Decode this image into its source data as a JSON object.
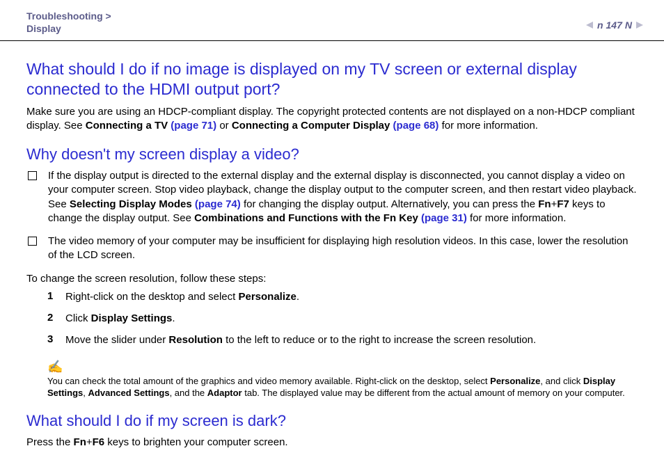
{
  "header": {
    "breadcrumb_line1": "Troubleshooting >",
    "breadcrumb_line2": "Display",
    "page_number": "147",
    "n_char": "n",
    "N_char": "N"
  },
  "q1": {
    "title": "What should I do if no image is displayed on my TV screen or external display connected to the HDMI output port?",
    "p_pre": "Make sure you are using an HDCP-compliant display. The copyright protected contents are not displayed on a non-HDCP compliant display. See ",
    "link1_bold": "Connecting a TV ",
    "link1_page": "(page 71)",
    "p_mid": " or ",
    "link2_bold": "Connecting a Computer Display ",
    "link2_page": "(page 68)",
    "p_post": " for more information."
  },
  "q2": {
    "title": "Why doesn't my screen display a video?",
    "bullet1": {
      "a": "If the display output is directed to the external display and the external display is disconnected, you cannot display a video on your computer screen. Stop video playback, change the display output to the computer screen, and then restart video playback. See ",
      "b_bold": "Selecting Display Modes ",
      "b_page": "(page 74)",
      "c": " for changing the display output. Alternatively, you can press the ",
      "fn": "Fn",
      "plus": "+",
      "f7": "F7",
      "d": " keys to change the display output. See ",
      "e_bold": "Combinations and Functions with the Fn Key ",
      "e_page": "(page 31)",
      "f": " for more information."
    },
    "bullet2": "The video memory of your computer may be insufficient for displaying high resolution videos. In this case, lower the resolution of the LCD screen.",
    "steps_intro": "To change the screen resolution, follow these steps:",
    "steps": [
      {
        "n": "1",
        "pre": "Right-click on the desktop and select ",
        "b": "Personalize",
        "post": "."
      },
      {
        "n": "2",
        "pre": "Click ",
        "b": "Display Settings",
        "post": "."
      },
      {
        "n": "3",
        "pre": "Move the slider under ",
        "b": "Resolution",
        "post": " to the left to reduce or to the right to increase the screen resolution."
      }
    ],
    "note_icon": "✍",
    "note": {
      "a": "You can check the total amount of the graphics and video memory available. Right-click on the desktop, select ",
      "b1": "Personalize",
      "c1": ", and click ",
      "b2": "Display Settings",
      "c2": ", ",
      "b3": "Advanced Settings",
      "c3": ", and the ",
      "b4": "Adaptor",
      "c4": " tab. The displayed value may be different from the actual amount of memory on your computer."
    }
  },
  "q3": {
    "title": "What should I do if my screen is dark?",
    "p_pre": "Press the ",
    "fn": "Fn",
    "plus": "+",
    "f6": "F6",
    "p_post": " keys to brighten your computer screen."
  }
}
